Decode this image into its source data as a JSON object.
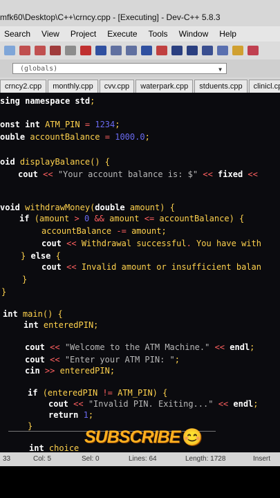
{
  "window": {
    "title": "mfk60\\Desktop\\C++\\crncy.cpp - [Executing] - Dev-C++ 5.8.3"
  },
  "menu": [
    "Search",
    "View",
    "Project",
    "Execute",
    "Tools",
    "Window",
    "Help"
  ],
  "scope": {
    "value": "(globals)"
  },
  "tabs": [
    "crncy2.cpp",
    "monthly.cpp",
    "cvv.cpp",
    "waterpark.cpp",
    "stduents.cpp",
    "clinicl.cpp"
  ],
  "code": [
    "sing namespace std;",
    "onst int ATM_PIN = 1234;",
    "ouble accountBalance = 1000.0;",
    "oid displayBalance() {",
    "cout << \"Your account balance is: $\" << fixed <<",
    "void withdrawMoney(double amount) {",
    "if (amount > 0 && amount <= accountBalance) {",
    "accountBalance -= amount;",
    "cout << \"Withdrawal successful. You have with",
    "} else {",
    "cout << \"Invalid amount or insufficient balan",
    "}",
    "}",
    "int main() {",
    "int enteredPIN;",
    "cout << \"Welcome to the ATM Machine.\" << endl;",
    "cout << \"Enter your ATM PIN: \";",
    "cin >> enteredPIN;",
    "if (enteredPIN != ATM_PIN) {",
    "cout << \"Invalid PIN. Exiting...\" << endl;",
    "return 1;",
    "}",
    "int choice"
  ],
  "overlay": {
    "text": "SUBSCRIBE",
    "emoji": "😊"
  },
  "status": {
    "line": "33",
    "col": "Col: 5",
    "sel": "Sel: 0",
    "lines": "Lines: 64",
    "length": "Length: 1728",
    "mode": "Insert"
  }
}
